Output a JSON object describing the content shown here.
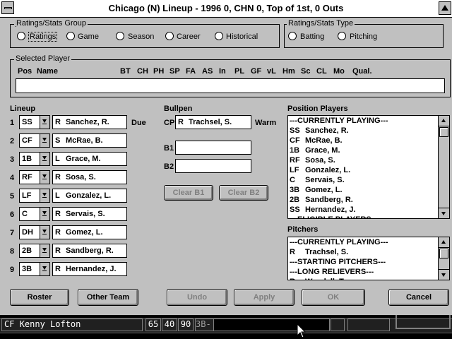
{
  "window": {
    "title": "Chicago (N)  Lineup - 1996 0, CHN 0, Top of 1st, 0 Outs"
  },
  "ratings_group": {
    "title": "Ratings/Stats Group",
    "options": [
      "Ratings",
      "Game",
      "Season",
      "Career",
      "Historical"
    ]
  },
  "ratings_type": {
    "title": "Ratings/Stats Type",
    "options": [
      "Batting",
      "Pitching"
    ]
  },
  "selected_player": {
    "title": "Selected Player",
    "headers": [
      "Pos",
      "Name",
      "BT",
      "CH",
      "PH",
      "SP",
      "FA",
      "AS",
      "In",
      "PL",
      "GF",
      "vL",
      "Hm",
      "Sc",
      "CL",
      "Mo",
      "Qual."
    ]
  },
  "lineup": {
    "title": "Lineup",
    "due_label": "Due",
    "rows": [
      {
        "num": "1",
        "pos": "SS",
        "hand": "R",
        "name": "Sanchez, R."
      },
      {
        "num": "2",
        "pos": "CF",
        "hand": "S",
        "name": "McRae, B."
      },
      {
        "num": "3",
        "pos": "1B",
        "hand": "L",
        "name": "Grace, M."
      },
      {
        "num": "4",
        "pos": "RF",
        "hand": "R",
        "name": "Sosa, S."
      },
      {
        "num": "5",
        "pos": "LF",
        "hand": "L",
        "name": "Gonzalez, L."
      },
      {
        "num": "6",
        "pos": "C",
        "hand": "R",
        "name": "Servais, S."
      },
      {
        "num": "7",
        "pos": "DH",
        "hand": "R",
        "name": "Gomez, L."
      },
      {
        "num": "8",
        "pos": "2B",
        "hand": "R",
        "name": "Sandberg, R."
      },
      {
        "num": "9",
        "pos": "3B",
        "hand": "R",
        "name": "Hernandez, J."
      }
    ]
  },
  "bullpen": {
    "title": "Bullpen",
    "cp_label": "CP",
    "cp_hand": "R",
    "cp_name": "Trachsel, S.",
    "warm_label": "Warm",
    "b1_label": "B1",
    "b2_label": "B2",
    "clear_b1": "Clear B1",
    "clear_b2": "Clear B2"
  },
  "position_players": {
    "title": "Position Players",
    "items": [
      {
        "pos": "",
        "name": "---CURRENTLY PLAYING---"
      },
      {
        "pos": "SS",
        "name": "Sanchez, R."
      },
      {
        "pos": "CF",
        "name": "McRae, B."
      },
      {
        "pos": "1B",
        "name": "Grace, M."
      },
      {
        "pos": "RF",
        "name": "Sosa, S."
      },
      {
        "pos": "LF",
        "name": "Gonzalez, L."
      },
      {
        "pos": "C",
        "name": "Servais, S."
      },
      {
        "pos": "3B",
        "name": "Gomez, L."
      },
      {
        "pos": "2B",
        "name": "Sandberg, R."
      },
      {
        "pos": "SS",
        "name": "Hernandez, J."
      },
      {
        "pos": "",
        "name": "---ELIGIBLE PLAYERS---"
      }
    ]
  },
  "pitchers": {
    "title": "Pitchers",
    "items": [
      {
        "pos": "",
        "name": "---CURRENTLY PLAYING---"
      },
      {
        "pos": "R",
        "name": "Trachsel, S."
      },
      {
        "pos": "",
        "name": "---STARTING PITCHERS---"
      },
      {
        "pos": "",
        "name": "---LONG RELIEVERS---"
      },
      {
        "pos": "R",
        "name": "Wendell, T."
      }
    ]
  },
  "buttons": {
    "roster": "Roster",
    "other_team": "Other Team",
    "undo": "Undo",
    "apply": "Apply",
    "ok": "OK",
    "cancel": "Cancel"
  },
  "statusbar": {
    "pos": "CF",
    "player": "Kenny Lofton",
    "n1": "65",
    "n2": "40",
    "n3": "90",
    "base": "3B-"
  }
}
